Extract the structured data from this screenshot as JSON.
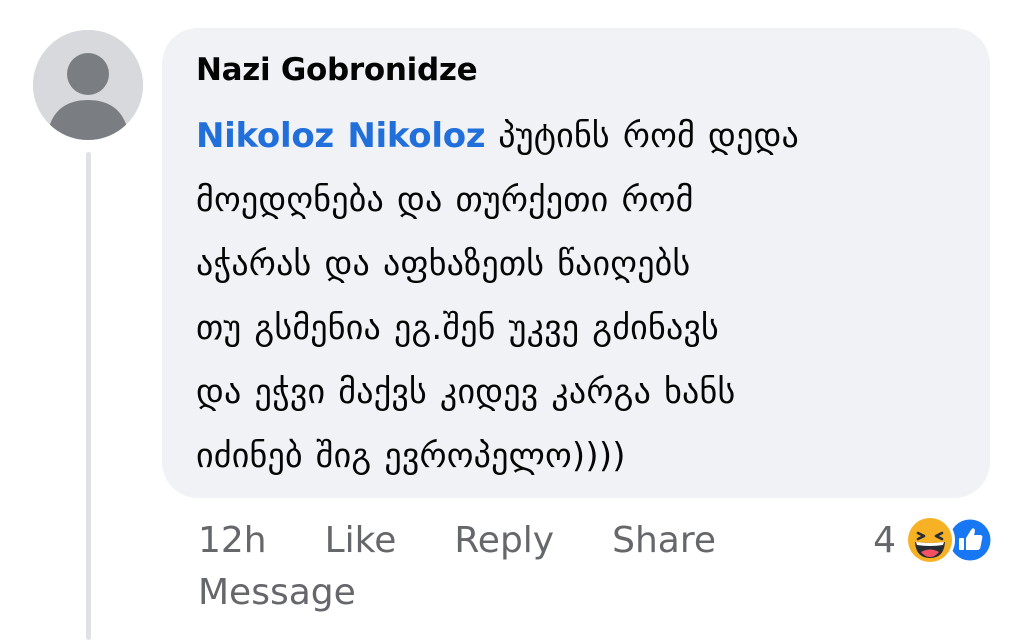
{
  "comment": {
    "author": "Nazi Gobronidze",
    "mention": "Nikoloz Nikoloz",
    "lines": [
      " პუტინს რომ დედა",
      "მოედღნება და თურქეთი რომ",
      "აჭარას და აფხაზეთს წაიღებს",
      "თუ გსმენია ეგ.შენ უკვე გძინავს",
      "და ეჭვი მაქვს კიდევ კარგა ხანს",
      "იძინებ შიგ ევროპელო))))"
    ]
  },
  "actions": {
    "timestamp": "12h",
    "like_label": "Like",
    "reply_label": "Reply",
    "share_label": "Share",
    "message_label": "Message"
  },
  "reactions": {
    "count": "4",
    "icons": [
      "haha-reaction-icon",
      "like-reaction-icon"
    ]
  },
  "colors": {
    "bubble_bg": "#f0f2f5",
    "mention": "#216fdb",
    "secondary_text": "#65676b",
    "like_blue": "#1877f2",
    "haha_yellow": "#f7b125"
  }
}
